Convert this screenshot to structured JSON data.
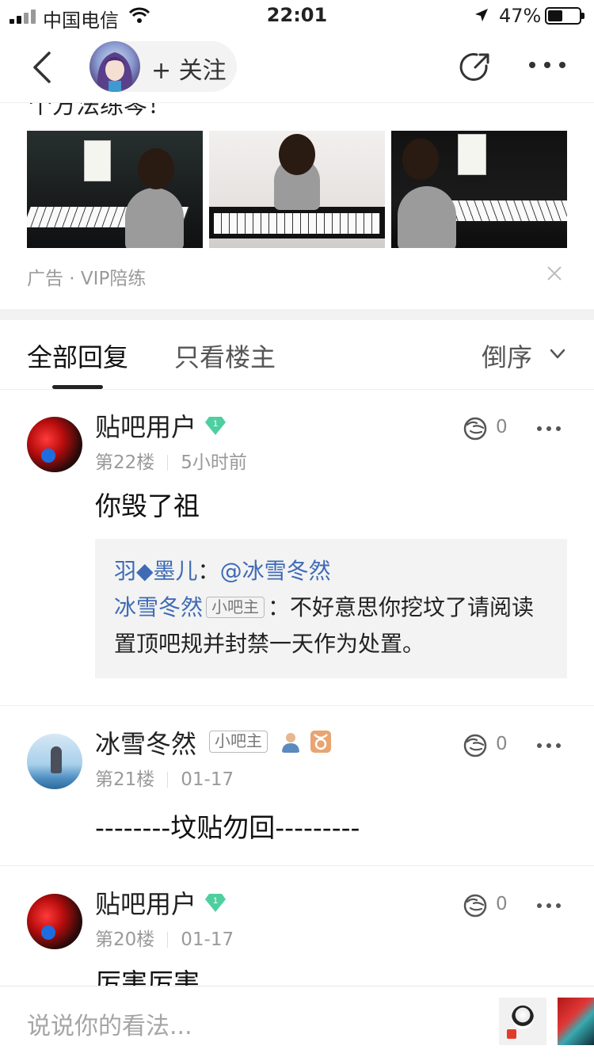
{
  "status_bar": {
    "carrier": "中国电信",
    "time": "22:01",
    "battery": "47%",
    "battery_level": 0.47
  },
  "nav": {
    "follow_label": "+ 关注"
  },
  "ad": {
    "title_fragment": "个方法练琴！",
    "meta": "广告 · VIP陪练"
  },
  "tabs": {
    "all": "全部回复",
    "owner_only": "只看楼主",
    "sort": "倒序"
  },
  "posts": [
    {
      "user": "贴吧用户",
      "level": "1",
      "floor": "第22楼",
      "time": "5小时前",
      "likes": "0",
      "content": "你毁了祖",
      "quote": {
        "name1": "羽◆墨儿",
        "colon1": "：",
        "mention": "@冰雪冬然",
        "name2": "冰雪冬然",
        "tag": "小吧主",
        "colon2": "：",
        "text": "不好意思你挖坟了请阅读置顶吧规并封禁一天作为处置。"
      }
    },
    {
      "user": "冰雪冬然",
      "badge": "小吧主",
      "floor": "第21楼",
      "time": "01-17",
      "likes": "0",
      "content": "--------坟贴勿回---------"
    },
    {
      "user": "贴吧用户",
      "level": "1",
      "floor": "第20楼",
      "time": "01-17",
      "likes": "0",
      "content": "厉害厉害"
    }
  ],
  "comment_bar": {
    "placeholder": "说说你的看法..."
  },
  "colors": {
    "link_blue": "#3f6bb5",
    "gem_green": "#4fcf9f",
    "sep_gray": "#f2f2f2"
  }
}
